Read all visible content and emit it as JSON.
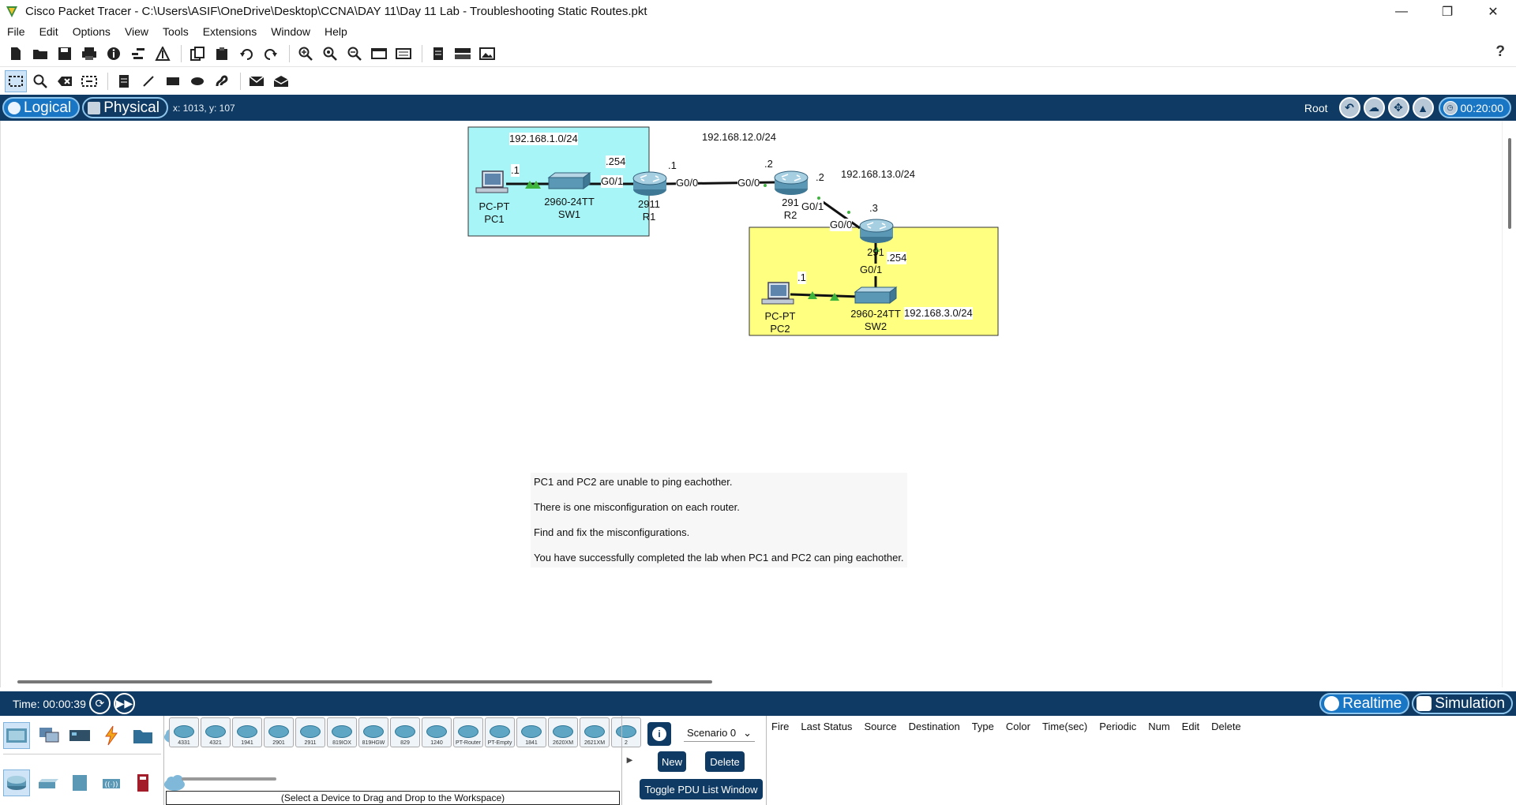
{
  "window": {
    "title": "Cisco Packet Tracer - C:\\Users\\ASIF\\OneDrive\\Desktop\\CCNA\\DAY 11\\Day 11 Lab - Troubleshooting Static Routes.pkt",
    "controls": [
      "—",
      "❐",
      "✕"
    ]
  },
  "menu": [
    "File",
    "Edit",
    "Options",
    "View",
    "Tools",
    "Extensions",
    "Window",
    "Help"
  ],
  "help_label": "?",
  "viewbar": {
    "logical": "Logical",
    "physical": "Physical",
    "coords": "x: 1013, y: 107",
    "root": "Root",
    "clock": "00:20:00"
  },
  "topology": {
    "networks": {
      "net1": "192.168.1.0/24",
      "net12": "192.168.12.0/24",
      "net13": "192.168.13.0/24",
      "net3": "192.168.3.0/24"
    },
    "labels": {
      "pc1_ip": ".1",
      "r1_lan_ip": ".254",
      "r1_wan_ip": ".1",
      "r1_g01": "G0/1",
      "r1_g00": "G0/0",
      "r2_g00": "G0/0",
      "r2_ip12": ".2",
      "r2_ip13": ".2",
      "r2_g01": "G0/1",
      "r3_ip13": ".3",
      "r3_g00": "G0/0",
      "r3_g01": "G0/1",
      "r3_lan_ip": ".254",
      "pc2_ip": ".1"
    },
    "devices": {
      "pc1_model": "PC-PT",
      "pc1_name": "PC1",
      "sw1_model": "2960-24TT",
      "sw1_name": "SW1",
      "r1_model": "2911",
      "r1_name": "R1",
      "r2_model": "291",
      "r2_name": "R2",
      "r3_model": "291",
      "pc2_model": "PC-PT",
      "pc2_name": "PC2",
      "sw2_model": "2960-24TT",
      "sw2_name": "SW2"
    },
    "colors": {
      "lan1": "#a8f5f7",
      "lan3": "#ffff80",
      "link_up": "#3db53d"
    }
  },
  "note": [
    "PC1 and PC2 are unable to ping eachother.",
    "There is one misconfiguration on each router.",
    "Find and fix the misconfigurations.",
    "You have successfully completed the lab when PC1 and PC2 can ping eachother."
  ],
  "timebar": {
    "time": "Time: 00:00:39",
    "realtime": "Realtime",
    "simulation": "Simulation"
  },
  "device_models": [
    "4331",
    "4321",
    "1941",
    "2901",
    "2911",
    "819IOX",
    "819HGW",
    "829",
    "1240",
    "PT-Router",
    "PT-Empty",
    "1841",
    "2620XM",
    "2621XM",
    "2"
  ],
  "device_hint": "(Select a Device to Drag and Drop to the Workspace)",
  "scenario": {
    "selected": "Scenario 0",
    "new": "New",
    "delete": "Delete",
    "toggle": "Toggle PDU List Window"
  },
  "pdu_columns": [
    "Fire",
    "Last Status",
    "Source",
    "Destination",
    "Type",
    "Color",
    "Time(sec)",
    "Periodic",
    "Num",
    "Edit",
    "Delete"
  ]
}
